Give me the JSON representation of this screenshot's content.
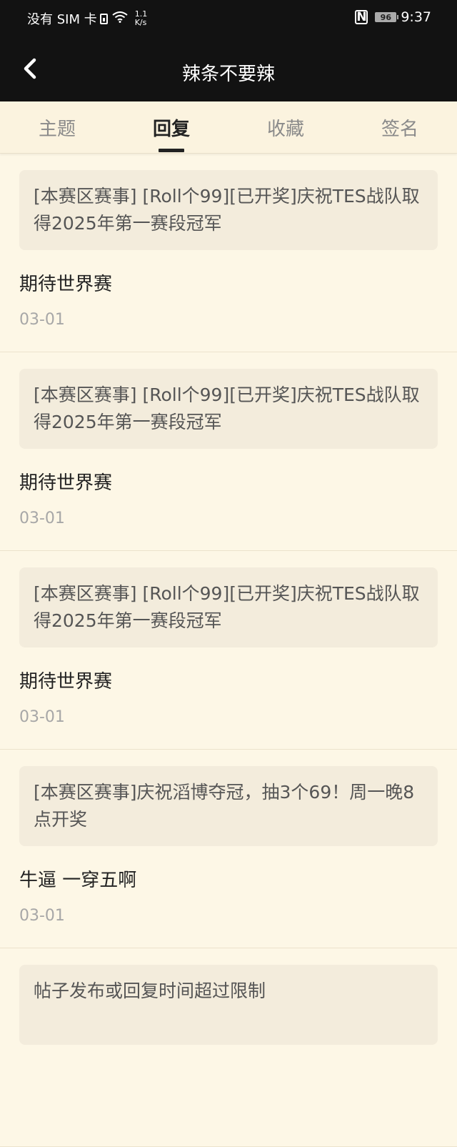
{
  "status_bar": {
    "carrier": "没有 SIM 卡",
    "net_speed_value": "1.1",
    "net_speed_unit": "K/s",
    "nfc": "N",
    "battery": "96",
    "time": "9:37"
  },
  "app_bar": {
    "title": "辣条不要辣"
  },
  "tabs": [
    {
      "label": "主题",
      "active": false
    },
    {
      "label": "回复",
      "active": true
    },
    {
      "label": "收藏",
      "active": false
    },
    {
      "label": "签名",
      "active": false
    }
  ],
  "replies": [
    {
      "quote": "[本赛区赛事] [Roll个99][已开奖]庆祝TES战队取得2025年第一赛段冠军",
      "content": "期待世界赛",
      "date": "03-01"
    },
    {
      "quote": "[本赛区赛事] [Roll个99][已开奖]庆祝TES战队取得2025年第一赛段冠军",
      "content": "期待世界赛",
      "date": "03-01"
    },
    {
      "quote": "[本赛区赛事] [Roll个99][已开奖]庆祝TES战队取得2025年第一赛段冠军",
      "content": "期待世界赛",
      "date": "03-01"
    },
    {
      "quote": "[本赛区赛事]庆祝滔博夺冠，抽3个69！周一晚8点开奖",
      "content": "牛逼 一穿五啊",
      "date": "03-01"
    },
    {
      "quote": "帖子发布或回复时间超过限制",
      "content": "",
      "date": ""
    }
  ]
}
